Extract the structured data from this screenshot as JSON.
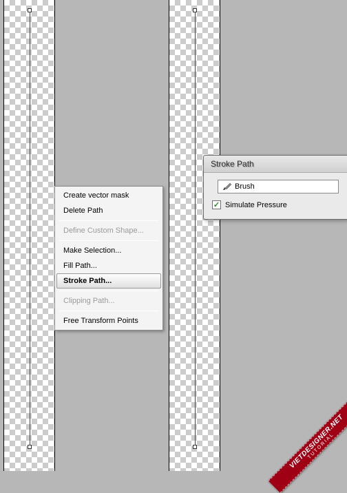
{
  "context_menu": {
    "items": [
      {
        "label": "Create vector mask",
        "disabled": false
      },
      {
        "label": "Delete Path",
        "disabled": false
      },
      {
        "sep": true
      },
      {
        "label": "Define Custom Shape...",
        "disabled": true
      },
      {
        "sep": true
      },
      {
        "label": "Make Selection...",
        "disabled": false
      },
      {
        "label": "Fill Path...",
        "disabled": false
      },
      {
        "label": "Stroke Path...",
        "disabled": false,
        "highlighted": true
      },
      {
        "sep": true
      },
      {
        "label": "Clipping Path...",
        "disabled": true
      },
      {
        "sep": true
      },
      {
        "label": "Free Transform Points",
        "disabled": false
      }
    ]
  },
  "dialog": {
    "title": "Stroke Path",
    "tool_label": "Brush",
    "simulate_pressure_label": "Simulate Pressure",
    "simulate_pressure_checked": true
  },
  "ribbon": {
    "main": "VIETDESIGNER.NET",
    "sub": "TUTORIAL"
  }
}
